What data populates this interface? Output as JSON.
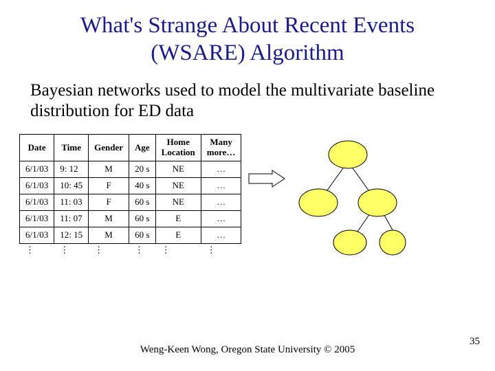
{
  "title_line1": "What's Strange About Recent Events",
  "title_line2": "(WSARE) Algorithm",
  "subtitle": "Bayesian networks used to model the multivariate baseline distribution for ED data",
  "table": {
    "headers": [
      "Date",
      "Time",
      "Gender",
      "Age",
      "Home\nLocation",
      "Many\nmore…"
    ],
    "rows": [
      [
        "6/1/03",
        "9: 12",
        "M",
        "20 s",
        "NE",
        "…"
      ],
      [
        "6/1/03",
        "10: 45",
        "F",
        "40 s",
        "NE",
        "…"
      ],
      [
        "6/1/03",
        "11: 03",
        "F",
        "60 s",
        "NE",
        "…"
      ],
      [
        "6/1/03",
        "11: 07",
        "M",
        "60 s",
        "E",
        "…"
      ],
      [
        "6/1/03",
        "12: 15",
        "M",
        "60 s",
        "E",
        "…"
      ]
    ],
    "vdots": "⋮"
  },
  "footer": "Weng-Keen Wong, Oregon State University © 2005",
  "page_number": "35"
}
